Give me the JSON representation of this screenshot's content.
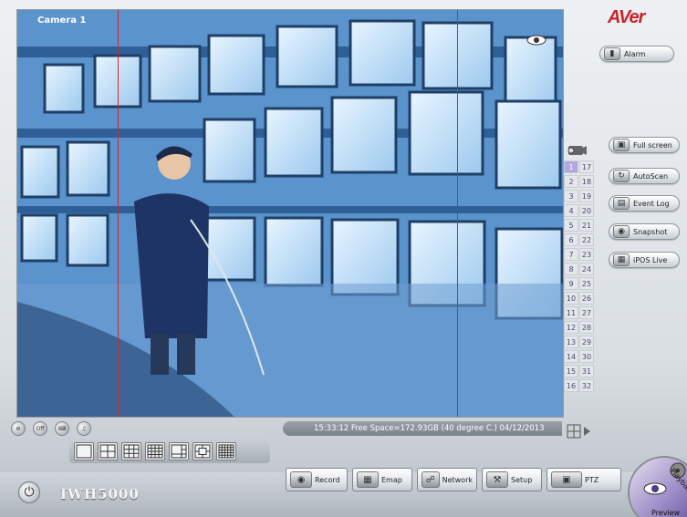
{
  "app": {
    "logo": "AVer",
    "model": "IWH5000"
  },
  "video": {
    "camera_label": "Camera 1"
  },
  "channels": {
    "left": [
      "1",
      "2",
      "3",
      "4",
      "5",
      "6",
      "7",
      "8",
      "9",
      "10",
      "11",
      "12",
      "13",
      "14",
      "15",
      "16"
    ],
    "right": [
      "17",
      "18",
      "19",
      "20",
      "21",
      "22",
      "23",
      "24",
      "25",
      "26",
      "27",
      "28",
      "29",
      "30",
      "31",
      "32"
    ],
    "active": "1"
  },
  "status_bar": {
    "text": "15:33:12  Free Space=172.93GB (40 degree C.) 04/12/2013"
  },
  "right_panel": {
    "alarm": "Alarm",
    "full_screen": "Full screen",
    "autoscan": "AutoScan",
    "event_log": "Event Log",
    "snapshot": "Snapshot",
    "ipos_live": "iPOS Live"
  },
  "mini_icons": {
    "off_label": "Off"
  },
  "toolbar": {
    "record": "Record",
    "emap": "Emap",
    "network": "Network",
    "setup": "Setup",
    "ptz": "PTZ"
  },
  "wheel": {
    "playback": "Playback",
    "preview": "Preview"
  },
  "colors": {
    "logo_red": "#c8242b",
    "active_channel": "#b3a7e0",
    "split_line": "#d0282a"
  }
}
